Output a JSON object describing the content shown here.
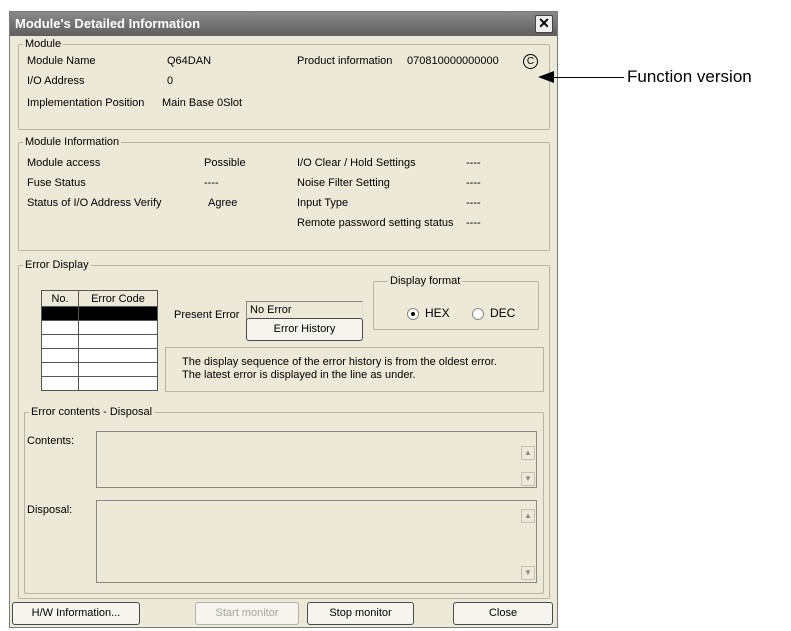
{
  "dialog": {
    "title": "Module's Detailed Information",
    "close_glyph": "✕"
  },
  "module": {
    "legend": "Module",
    "name_label": "Module Name",
    "name_value": "Q64DAN",
    "io_address_label": "I/O Address",
    "io_address_value": "0",
    "impl_position_label": "Implementation Position",
    "impl_position_value": "Main Base  0Slot",
    "product_info_label": "Product information",
    "product_info_value": "070810000000000",
    "function_version": "C"
  },
  "module_info": {
    "legend": "Module Information",
    "access_label": "Module access",
    "access_value": "Possible",
    "fuse_label": "Fuse Status",
    "fuse_value": "----",
    "verify_label": "Status of I/O Address Verify",
    "verify_value": "Agree",
    "io_clear_label": "I/O Clear / Hold Settings",
    "io_clear_value": "----",
    "noise_label": "Noise Filter Setting",
    "noise_value": "----",
    "input_type_label": "Input Type",
    "input_type_value": "----",
    "remote_pw_label": "Remote password setting status",
    "remote_pw_value": "----"
  },
  "error_display": {
    "legend": "Error Display",
    "table_headers": [
      "No.",
      "Error Code"
    ],
    "present_error_label": "Present Error",
    "present_error_value": "No Error",
    "error_history_button": "Error History",
    "display_format_legend": "Display format",
    "format_options": [
      "HEX",
      "DEC"
    ],
    "selected_format": "HEX",
    "note_line1": "The display sequence of the error history is from the oldest error.",
    "note_line2": "The latest error is displayed in the line as under."
  },
  "error_contents": {
    "legend": "Error contents - Disposal",
    "contents_label": "Contents:",
    "disposal_label": "Disposal:"
  },
  "buttons": {
    "hw_info": "H/W Information...",
    "start_monitor": "Start monitor",
    "stop_monitor": "Stop monitor",
    "close": "Close"
  },
  "annotation": {
    "function_version_label": "Function version"
  }
}
